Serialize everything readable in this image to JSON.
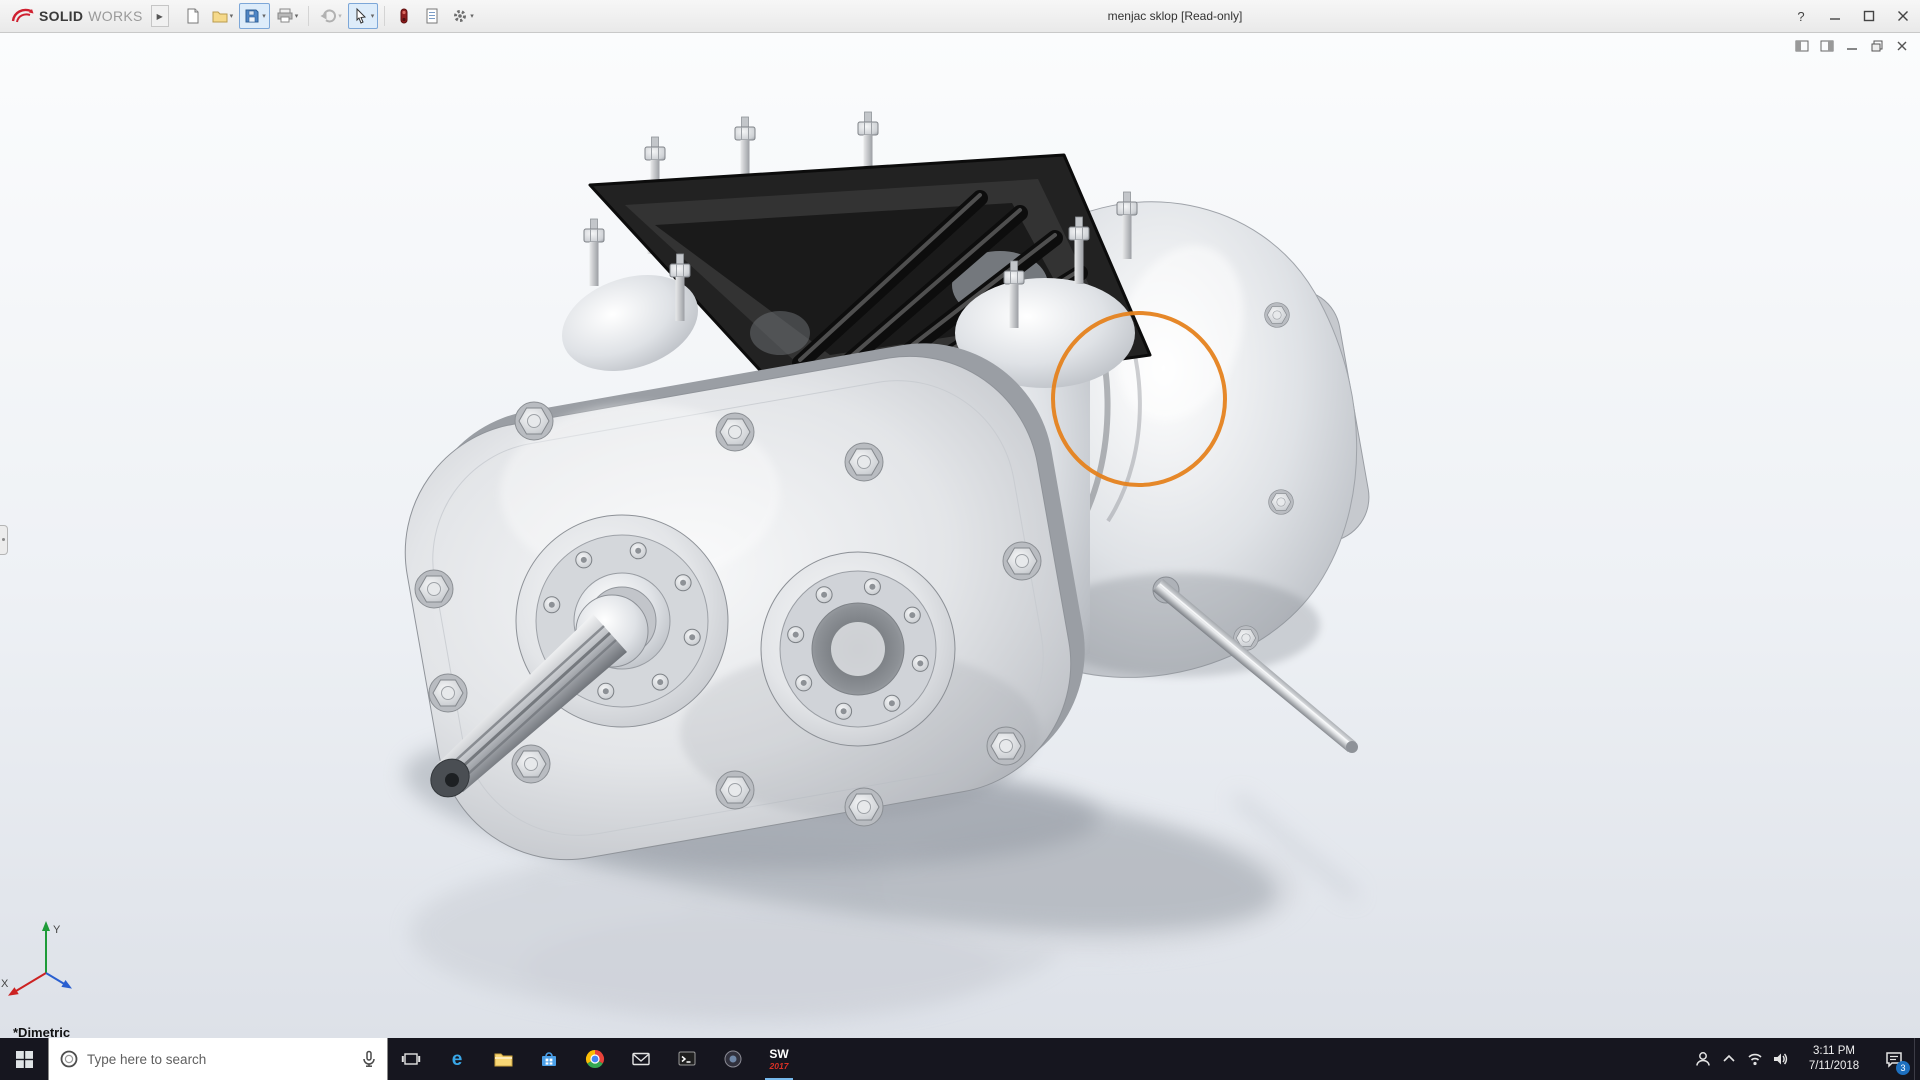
{
  "titlebar": {
    "brand_solid": "SOLID",
    "brand_works": "WORKS",
    "document_title": "menjac sklop [Read-only]",
    "help_glyph": "?"
  },
  "toolbar": {
    "flyout_glyph": "▶",
    "caret_glyph": "▾",
    "icons": [
      "new-document",
      "open",
      "save",
      "print",
      "undo",
      "select",
      "rebuild",
      "file-properties",
      "options"
    ]
  },
  "viewport": {
    "view_orientation": "*Dimetric",
    "triad_x": "X",
    "triad_y": "Y",
    "annotation": {
      "shape": "circle",
      "color": "#E5821E"
    }
  },
  "taskbar": {
    "search_placeholder": "Type here to search",
    "edge_glyph": "e",
    "solidworks_label": "SW",
    "solidworks_year": "2017",
    "time": "3:11 PM",
    "date": "7/11/2018",
    "notification_count": "3",
    "app_icons": [
      "task-view",
      "edge",
      "file-explorer",
      "store",
      "chrome",
      "mail",
      "command-prompt",
      "generic-app",
      "solidworks"
    ],
    "tray_icons": [
      "people",
      "hidden-icons",
      "network",
      "volume",
      "action-center"
    ]
  }
}
